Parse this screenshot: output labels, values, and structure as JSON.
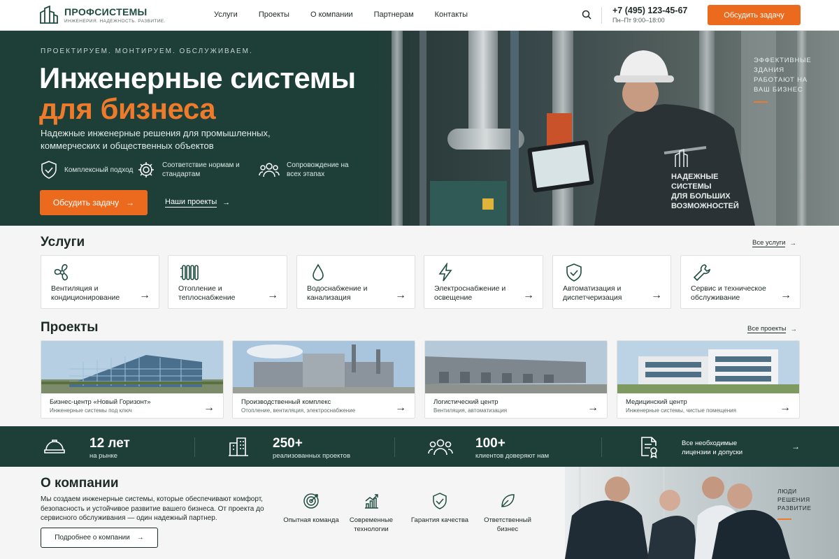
{
  "header": {
    "logo_name": "ПРОФСИСТЕМЫ",
    "logo_tagline": "ИНЖЕНЕРИЯ. НАДЕЖНОСТЬ. РАЗВИТИЕ.",
    "nav": [
      "Услуги",
      "Проекты",
      "О компании",
      "Партнерам",
      "Контакты"
    ],
    "phone": "+7 (495) 123-45-67",
    "hours": "Пн–Пт 9:00–18:00",
    "cta": "Обсудить задачу"
  },
  "hero": {
    "eyebrow": "ПРОЕКТИРУЕМ. МОНТИРУЕМ. ОБСЛУЖИВАЕМ.",
    "title_line1": "Инженерные системы",
    "title_line2": "для бизнеса",
    "subtitle": "Надежные инженерные решения для промышленных, коммерческих и общественных объектов",
    "features": [
      {
        "label": "Комплексный подход",
        "icon": "shield-check-icon"
      },
      {
        "label": "Соответствие нормам и стандартам",
        "icon": "gear-icon"
      },
      {
        "label": "Сопровождение на всех этапах",
        "icon": "people-icon"
      }
    ],
    "cta": "Обсудить задачу",
    "link": "Наши проекты",
    "side_text": "ЭФФЕКТИВНЫЕ ЗДАНИЯ РАБОТАЮТ НА ВАШ БИЗНЕС",
    "jacket_text": "НАДЕЖНЫЕ СИСТЕМЫ ДЛЯ БОЛЬШИХ ВОЗМОЖНОСТЕЙ"
  },
  "services": {
    "title": "Услуги",
    "all_link": "Все услуги",
    "items": [
      {
        "label": "Вентиляция и кондиционирование",
        "icon": "fan-icon"
      },
      {
        "label": "Отопление и теплоснабжение",
        "icon": "radiator-icon"
      },
      {
        "label": "Водоснабжение и канализация",
        "icon": "water-drop-icon"
      },
      {
        "label": "Электроснабжение и освещение",
        "icon": "lightning-icon"
      },
      {
        "label": "Автоматизация и диспетчеризация",
        "icon": "shield-check-icon"
      },
      {
        "label": "Сервис и техническое обслуживание",
        "icon": "wrench-icon"
      }
    ]
  },
  "projects": {
    "title": "Проекты",
    "all_link": "Все проекты",
    "items": [
      {
        "title": "Бизнес-центр «Новый Горизонт»",
        "subtitle": "Инженерные системы под ключ"
      },
      {
        "title": "Производственный комплекс",
        "subtitle": "Отопление, вентиляция, электроснабжение"
      },
      {
        "title": "Логистический центр",
        "subtitle": "Вентиляция, автоматизация"
      },
      {
        "title": "Медицинский центр",
        "subtitle": "Инженерные системы, чистые помещения"
      }
    ]
  },
  "stats": [
    {
      "value": "12 лет",
      "label": "на рынке",
      "icon": "hard-hat-icon"
    },
    {
      "value": "250+",
      "label": "реализованных проектов",
      "icon": "buildings-icon"
    },
    {
      "value": "100+",
      "label": "клиентов доверяют нам",
      "icon": "people-icon"
    },
    {
      "value": "",
      "label": "Все необходимые лицензии и допуски",
      "icon": "certificate-icon"
    }
  ],
  "about": {
    "title": "О компании",
    "text": "Мы создаем инженерные системы, которые обеспечивают комфорт, безопасность и устойчивое развитие вашего бизнеса. От проекта до сервисного обслуживания — один надежный партнер.",
    "button": "Подробнее о компании",
    "values": [
      {
        "label": "Опытная команда",
        "icon": "target-icon"
      },
      {
        "label": "Современные технологии",
        "icon": "chart-icon"
      },
      {
        "label": "Гарантия качества",
        "icon": "shield-check-icon"
      },
      {
        "label": "Ответственный бизнес",
        "icon": "leaf-icon"
      }
    ],
    "photo_tag": "ЛЮДИ РЕШЕНИЯ РАЗВИТИЕ"
  },
  "colors": {
    "brand_green": "#1d3f37",
    "accent_orange": "#ec6a1e"
  }
}
